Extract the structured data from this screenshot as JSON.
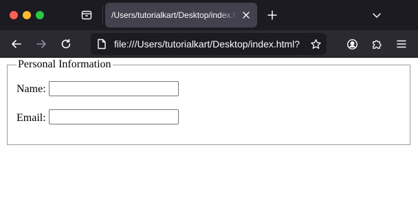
{
  "browser": {
    "tab_title": "/Users/tutorialkart/Desktop/index.html",
    "url": "file:///Users/tutorialkart/Desktop/index.html?",
    "icons": {
      "window_controls": [
        "close",
        "minimize",
        "zoom"
      ],
      "tabs_button": "tab-overview-icon",
      "tab_close": "close-icon",
      "new_tab": "plus-icon",
      "tab_list": "chevron-down-icon",
      "back": "arrow-left-icon",
      "forward": "arrow-right-icon",
      "reload": "reload-icon",
      "page": "page-icon",
      "bookmark": "star-icon",
      "account": "account-icon",
      "extensions": "puzzle-icon",
      "menu": "hamburger-icon"
    },
    "colors": {
      "titlebar": "#1c1b22",
      "toolbar": "#2b2a33",
      "active_tab": "#42414d",
      "close": "#ff5f57",
      "minimize": "#febc2e",
      "zoom": "#28c840"
    }
  },
  "page": {
    "form": {
      "legend": "Personal Information",
      "fields": [
        {
          "label": "Name:",
          "value": ""
        },
        {
          "label": "Email:",
          "value": ""
        }
      ]
    }
  }
}
